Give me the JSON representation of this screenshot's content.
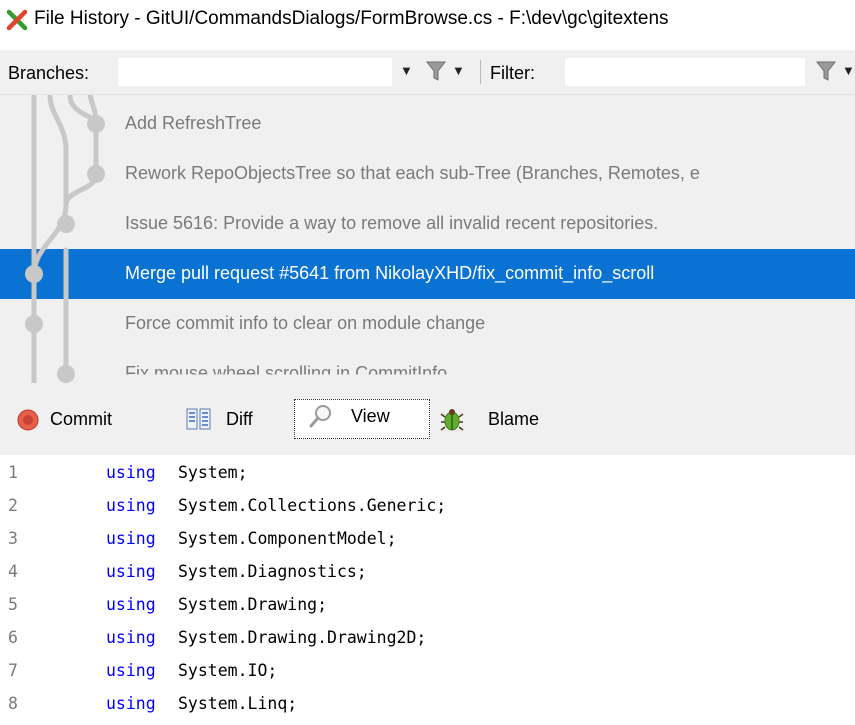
{
  "window": {
    "title": "File History - GitUI/CommandsDialogs/FormBrowse.cs - F:\\dev\\gc\\gitextens"
  },
  "toolbar": {
    "branches_label": "Branches:",
    "filter_label": "Filter:",
    "branches_value": "",
    "filter_value": ""
  },
  "commits": [
    {
      "message": "Add RefreshTree",
      "selected": false
    },
    {
      "message": "Rework RepoObjectsTree so that each sub-Tree (Branches, Remotes, e",
      "selected": false
    },
    {
      "message": "Issue 5616: Provide a way to remove all invalid recent repositories.",
      "selected": false
    },
    {
      "message": "Merge pull request #5641 from NikolayXHD/fix_commit_info_scroll",
      "selected": true
    },
    {
      "message": "Force commit info to clear on module change",
      "selected": false
    },
    {
      "message": "Fix mouse wheel scrolling in CommitInfo",
      "selected": false
    }
  ],
  "tabs": [
    {
      "label": "Commit",
      "icon": "commit-icon",
      "active": false
    },
    {
      "label": "Diff",
      "icon": "diff-icon",
      "active": false
    },
    {
      "label": "View",
      "icon": "view-icon",
      "active": true
    },
    {
      "label": "Blame",
      "icon": "blame-icon",
      "active": false
    }
  ],
  "code_lines": [
    {
      "num": "1",
      "keyword": "using",
      "name": "System;"
    },
    {
      "num": "2",
      "keyword": "using",
      "name": "System.Collections.Generic;"
    },
    {
      "num": "3",
      "keyword": "using",
      "name": "System.ComponentModel;"
    },
    {
      "num": "4",
      "keyword": "using",
      "name": "System.Diagnostics;"
    },
    {
      "num": "5",
      "keyword": "using",
      "name": "System.Drawing;"
    },
    {
      "num": "6",
      "keyword": "using",
      "name": "System.Drawing.Drawing2D;"
    },
    {
      "num": "7",
      "keyword": "using",
      "name": "System.IO;"
    },
    {
      "num": "8",
      "keyword": "using",
      "name": "System.Linq;"
    }
  ],
  "colors": {
    "selection": "#0a72d3",
    "keyword": "#0000ff",
    "graph_line": "#c8c8c8"
  }
}
